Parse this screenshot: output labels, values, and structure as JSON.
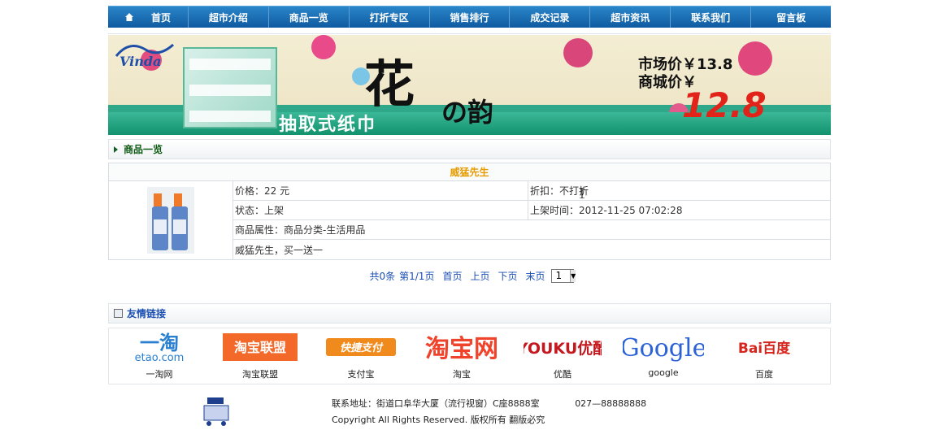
{
  "nav": {
    "items": [
      {
        "label": "首页",
        "icon": "home-icon"
      },
      {
        "label": "超市介绍"
      },
      {
        "label": "商品一览"
      },
      {
        "label": "打折专区"
      },
      {
        "label": "销售排行"
      },
      {
        "label": "成交记录"
      },
      {
        "label": "超市资讯"
      },
      {
        "label": "联系我们"
      },
      {
        "label": "留言板"
      }
    ]
  },
  "banner": {
    "brand": "Vinda",
    "calligraphy_main": "花",
    "calligraphy_secondary": "の韵",
    "subtitle": "抽取式纸巾",
    "market_price": "市场价￥13.8",
    "mall_price_label": "商城价￥",
    "mall_price": "12.8"
  },
  "section_products": {
    "title": "商品一览"
  },
  "product": {
    "name": "威猛先生",
    "price": "价格：22 元",
    "discount": "折扣：不打折",
    "status": "状态：上架",
    "listed_time": "上架时间：2012-11-25 07:02:28",
    "attribute": "商品属性：商品分类-生活用品",
    "description": "威猛先生，买一送一"
  },
  "pager": {
    "total": "共0条",
    "page_info": "第1/1页",
    "first": "首页",
    "prev": "上页",
    "next": "下页",
    "last": "末页",
    "selected_page": "1"
  },
  "section_links": {
    "title": "友情链接"
  },
  "links": [
    {
      "label": "一淘网",
      "logo": "etao-logo"
    },
    {
      "label": "淘宝联盟",
      "logo": "taobao-union-logo"
    },
    {
      "label": "支付宝",
      "logo": "alipay-logo"
    },
    {
      "label": "淘宝",
      "logo": "taobao-logo"
    },
    {
      "label": "优酷",
      "logo": "youku-logo"
    },
    {
      "label": "google",
      "logo": "google-logo"
    },
    {
      "label": "百度",
      "logo": "baidu-logo"
    }
  ],
  "logo_text": {
    "etao": "一淘",
    "etao_sub": "etao.com",
    "taobao_union": "淘宝联盟",
    "alipay": "快捷支付",
    "taobao": "淘宝网",
    "youku": "YOUKU优酷",
    "google": "Google",
    "baidu": "Bai百度"
  },
  "footer": {
    "address": "联系地址：街道口阜华大厦（流行视窗）C座8888室",
    "phone": "027—88888888",
    "copyright": "Copyright All Rights Reserved. 版权所有  翻版必究"
  },
  "colors": {
    "nav_bg": "#1a6fb6",
    "section_title": "#0d5a13",
    "product_name": "#e69b00",
    "pager_link": "#1b4fb3"
  }
}
